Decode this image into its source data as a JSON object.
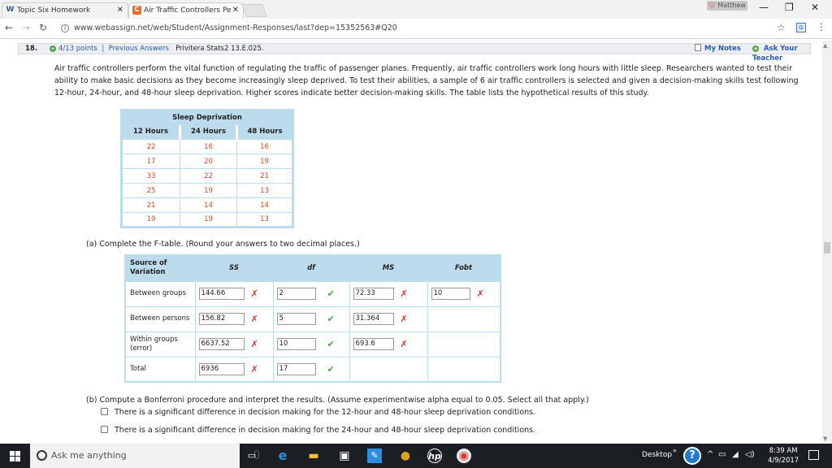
{
  "browser": {
    "tabs": [
      {
        "favicon": "webassign-icon",
        "label": "Topic Six Homework"
      },
      {
        "favicon": "c-icon",
        "label": "Air Traffic Controllers Pe"
      }
    ],
    "user": "Matthew",
    "url": "www.webassign.net/web/Student/Assignment-Responses/last?dep=15352563#Q20"
  },
  "question": {
    "number": "18.",
    "points": "4/13 points",
    "separator": "|",
    "previous": "Previous Answers",
    "source": "Privitera Stats2 13.E.025.",
    "my_notes": "My Notes",
    "ask_teacher": "Ask Your Teacher"
  },
  "intro": "Air traffic controllers perform the vital function of regulating the traffic of passenger planes. Frequently, air traffic controllers work long hours with little sleep. Researchers wanted to test their ability to make basic decisions as they become increasingly sleep deprived. To test their abilities, a sample of 6 air traffic controllers is selected and given a decision-making skills test following 12-hour, 24-hour, and 48-hour sleep deprivation. Higher scores indicate better decision-making skills. The table lists the hypothetical results of this study.",
  "sleep_table": {
    "title": "Sleep Deprivation",
    "headers": [
      "12 Hours",
      "24 Hours",
      "48 Hours"
    ],
    "rows": [
      [
        "22",
        "16",
        "16"
      ],
      [
        "17",
        "20",
        "19"
      ],
      [
        "33",
        "22",
        "21"
      ],
      [
        "25",
        "19",
        "13"
      ],
      [
        "21",
        "14",
        "14"
      ],
      [
        "19",
        "19",
        "13"
      ]
    ]
  },
  "part_a": "(a) Complete the F-table. (Round your answers to two decimal places.)",
  "ftable": {
    "headers": {
      "source": "Source of Variation",
      "ss": "SS",
      "df": "df",
      "ms": "MS",
      "fobt": "Fobt"
    },
    "rows": [
      {
        "label": "Between groups",
        "ss": "144.66",
        "ss_mark": "✗",
        "df": "2",
        "df_mark": "✔",
        "ms": "72.33",
        "ms_mark": "✗",
        "f": "10",
        "f_mark": "✗"
      },
      {
        "label": "Between persons",
        "ss": "156.82",
        "ss_mark": "✗",
        "df": "5",
        "df_mark": "✔",
        "ms": "31.364",
        "ms_mark": "✗"
      },
      {
        "label": "Within groups (error)",
        "ss": "6637.52",
        "ss_mark": "✗",
        "df": "10",
        "df_mark": "✔",
        "ms": "693.6",
        "ms_mark": "✗"
      },
      {
        "label": "Total",
        "ss": "6936",
        "ss_mark": "✗",
        "df": "17",
        "df_mark": "✔"
      }
    ]
  },
  "part_b": "(b) Compute a Bonferroni procedure and interpret the results. (Assume experimentwise alpha equal to 0.05. Select all that apply.)",
  "options": [
    "There is a significant difference in decision making for the 12-hour and 48-hour sleep deprivation conditions.",
    "There is a significant difference in decision making for the 24-hour and 48-hour sleep deprivation conditions."
  ],
  "taskbar": {
    "search_placeholder": "Ask me anything",
    "desktop": "Desktop",
    "time": "8:39 AM",
    "date": "4/9/2017"
  }
}
